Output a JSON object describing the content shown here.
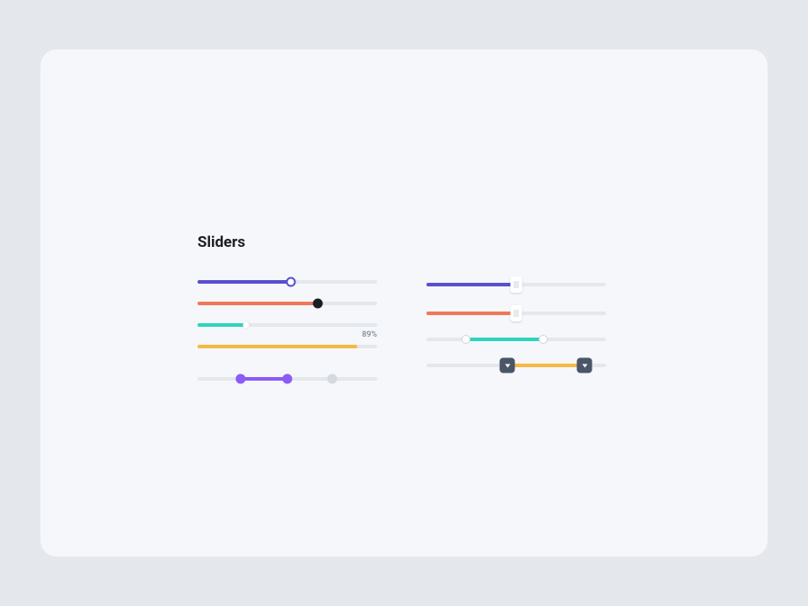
{
  "title": "Sliders",
  "colors": {
    "indigo": "#5a4fcf",
    "orange": "#f0785a",
    "teal": "#2dd4bf",
    "amber": "#f5b945",
    "violet": "#8b5cf6",
    "gray": "#d5dae1",
    "darksquare": "#4a5568",
    "black": "#1a1d23"
  },
  "sliders": {
    "left": [
      {
        "value": 52,
        "fillColor": "indigo",
        "thumb": {
          "style": "ring",
          "borderColor": "indigo"
        }
      },
      {
        "value": 67,
        "fillColor": "orange",
        "thumb": {
          "style": "solid",
          "bg": "black"
        }
      },
      {
        "value": 27,
        "fillColor": "teal",
        "thumb": {
          "style": "tiny"
        }
      },
      {
        "value": 89,
        "fillColor": "amber",
        "thumb": null,
        "valueLabel": "89%"
      },
      {
        "range": [
          24,
          50,
          75
        ],
        "fillColor": "violet",
        "thumbs": [
          {
            "style": "solid",
            "bg": "violet"
          },
          {
            "style": "solid",
            "bg": "violet"
          },
          {
            "style": "solid",
            "bg": "gray"
          }
        ]
      }
    ],
    "right": [
      {
        "value": 50,
        "fillColor": "indigo",
        "thumb": {
          "style": "rect"
        }
      },
      {
        "value": 50,
        "fillColor": "orange",
        "thumb": {
          "style": "rect"
        }
      },
      {
        "range": [
          22,
          65
        ],
        "fillColor": "teal",
        "thumbs": [
          {
            "style": "ringlg"
          },
          {
            "style": "ringlg"
          }
        ]
      },
      {
        "range": [
          45,
          88
        ],
        "fillColor": "amber",
        "thumbs": [
          {
            "style": "square",
            "bg": "darksquare"
          },
          {
            "style": "square",
            "bg": "darksquare"
          }
        ]
      }
    ]
  }
}
